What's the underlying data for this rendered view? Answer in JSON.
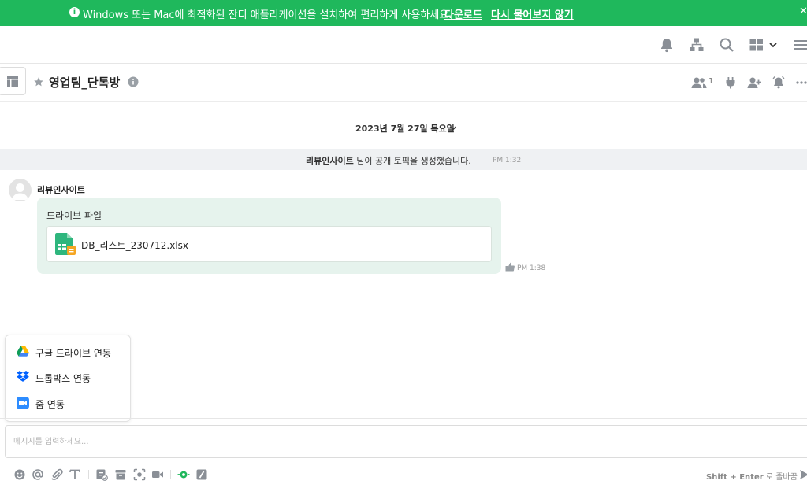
{
  "banner": {
    "message": "Windows 또는 Mac에 최적화된 잔디 애플리케이션을 설치하여 편리하게 사용하세요.",
    "download_label": "다운로드",
    "dismiss_label": "다시 물어보지 않기",
    "background": "#1fb85c"
  },
  "topbar": {
    "icons": [
      "bell-icon",
      "org-chart-icon",
      "search-icon",
      "apps-grid-icon",
      "chevron-down-icon",
      "menu-icon"
    ]
  },
  "room": {
    "title": "영업팀_단톡방",
    "member_count": "1"
  },
  "chat": {
    "date_label": "2023년 7월 27일 목요일",
    "system_message": {
      "user": "리뷰인사이트",
      "text": " 님이 공개 토픽을 생성했습니다.",
      "time": "PM 1:32"
    },
    "messages": [
      {
        "sender": "리뷰인사이트",
        "title": "드라이브 파일",
        "file_name": "DB_리스트_230712.xlsx",
        "time": "PM 1:38"
      }
    ]
  },
  "integrations_menu": {
    "items": [
      {
        "label": "구글 드라이브 연동",
        "icon": "google-drive-icon"
      },
      {
        "label": "드롭박스 연동",
        "icon": "dropbox-icon"
      },
      {
        "label": "줌 연동",
        "icon": "zoom-icon"
      }
    ]
  },
  "composer": {
    "placeholder": "메시지를 입력하세요...",
    "value": "",
    "hint_keys": "Shift + Enter",
    "hint_text": " 로 줄바꿈"
  },
  "colors": {
    "accent": "#1fb85c",
    "bubble": "#e6f3ed",
    "system_bg": "#eff1f3"
  }
}
